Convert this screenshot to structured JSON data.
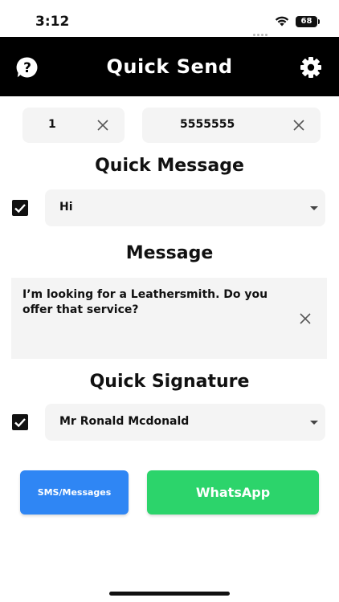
{
  "status_bar": {
    "time": "3:12",
    "battery": "68"
  },
  "header": {
    "title": "Quick Send",
    "help_icon": "help-bubble-icon",
    "settings_icon": "gear-icon"
  },
  "recipient": {
    "country_code": "1",
    "phone_number": "5555555"
  },
  "quick_message": {
    "title": "Quick Message",
    "checked": true,
    "selected": "Hi"
  },
  "message": {
    "title": "Message",
    "text": "I’m looking for a Leathersmith. Do you offer that service?"
  },
  "quick_signature": {
    "title": "Quick Signature",
    "checked": true,
    "selected": "Mr Ronald Mcdonald"
  },
  "actions": {
    "sms_label": "SMS/Messages",
    "whatsapp_label": "WhatsApp"
  },
  "colors": {
    "header_bg": "#000000",
    "field_bg": "#f4f4f4",
    "sms_blue": "#2f86f4",
    "whatsapp_green": "#2cd46b"
  }
}
